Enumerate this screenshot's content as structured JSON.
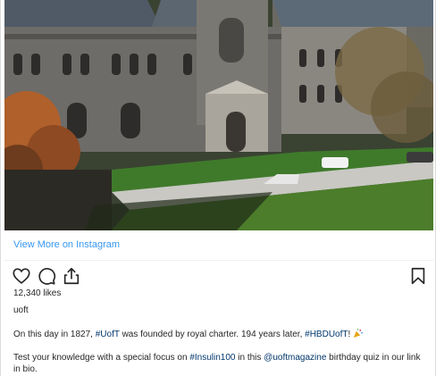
{
  "view_more_label": "View More on Instagram",
  "likes_text": "12,340 likes",
  "username": "uoft",
  "caption1": {
    "before_tag1": "On this day in 1827, ",
    "tag1": "#UofT",
    "middle": " was founded by royal charter. 194 years later, ",
    "tag2": "#HBDUofT",
    "after": "! "
  },
  "caption2": {
    "before_tag": "Test your knowledge with a special focus on ",
    "tag": "#Insulin100",
    "middle": " in this ",
    "mention": "@uoftmagazine",
    "after": " birthday quiz in our link in bio."
  },
  "icons": {
    "like": "heart-icon",
    "comment": "comment-icon",
    "share": "share-icon",
    "save": "bookmark-icon",
    "party": "party-popper-icon"
  },
  "colors": {
    "link": "#3897f0",
    "hashtag": "#00376b",
    "text": "#262626"
  }
}
